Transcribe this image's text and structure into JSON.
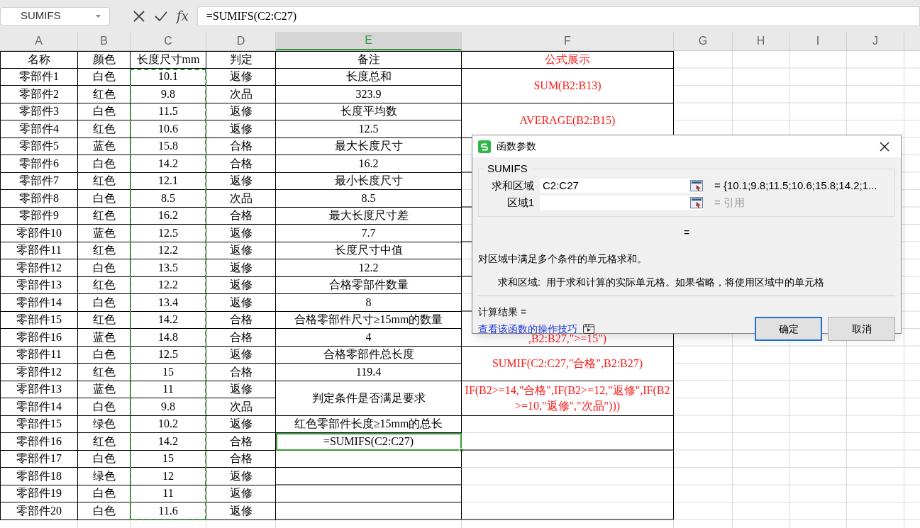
{
  "name_box": {
    "value": "SUMIFS"
  },
  "formula_bar": {
    "fx": "fx",
    "value": "=SUMIFS(C2:C27)"
  },
  "columns": [
    {
      "label": "A",
      "selected": false
    },
    {
      "label": "B",
      "selected": false
    },
    {
      "label": "C",
      "selected": false
    },
    {
      "label": "D",
      "selected": false
    },
    {
      "label": "E",
      "selected": true
    },
    {
      "label": "F",
      "selected": false
    },
    {
      "label": "G",
      "selected": false
    },
    {
      "label": "H",
      "selected": false
    },
    {
      "label": "I",
      "selected": false
    },
    {
      "label": "J",
      "selected": false
    }
  ],
  "table": {
    "header": [
      "名称",
      "颜色",
      "长度尺寸mm",
      "判定"
    ],
    "rows": [
      [
        "零部件1",
        "白色",
        "10.1",
        "返修"
      ],
      [
        "零部件2",
        "红色",
        "9.8",
        "次品"
      ],
      [
        "零部件3",
        "白色",
        "11.5",
        "返修"
      ],
      [
        "零部件4",
        "红色",
        "10.6",
        "返修"
      ],
      [
        "零部件5",
        "蓝色",
        "15.8",
        "合格"
      ],
      [
        "零部件6",
        "白色",
        "14.2",
        "合格"
      ],
      [
        "零部件7",
        "红色",
        "12.1",
        "返修"
      ],
      [
        "零部件8",
        "白色",
        "8.5",
        "次品"
      ],
      [
        "零部件9",
        "红色",
        "16.2",
        "合格"
      ],
      [
        "零部件10",
        "蓝色",
        "12.5",
        "返修"
      ],
      [
        "零部件11",
        "红色",
        "12.2",
        "返修"
      ],
      [
        "零部件12",
        "白色",
        "13.5",
        "返修"
      ],
      [
        "零部件13",
        "红色",
        "12.2",
        "返修"
      ],
      [
        "零部件14",
        "白色",
        "13.4",
        "返修"
      ],
      [
        "零部件15",
        "红色",
        "14.2",
        "合格"
      ],
      [
        "零部件16",
        "蓝色",
        "14.8",
        "合格"
      ],
      [
        "零部件11",
        "白色",
        "12.5",
        "返修"
      ],
      [
        "零部件12",
        "红色",
        "15",
        "合格"
      ],
      [
        "零部件13",
        "蓝色",
        "11",
        "返修"
      ],
      [
        "零部件14",
        "白色",
        "9.8",
        "次品"
      ],
      [
        "零部件15",
        "绿色",
        "10.2",
        "返修"
      ],
      [
        "零部件16",
        "红色",
        "14.2",
        "合格"
      ],
      [
        "零部件17",
        "白色",
        "15",
        "合格"
      ],
      [
        "零部件18",
        "绿色",
        "12",
        "返修"
      ],
      [
        "零部件19",
        "白色",
        "11",
        "返修"
      ],
      [
        "零部件20",
        "白色",
        "11.6",
        "返修"
      ]
    ]
  },
  "notes_column": [
    {
      "text": "备注",
      "kind": "single",
      "selected": false
    },
    {
      "text": "长度总和",
      "kind": "single",
      "selected": false
    },
    {
      "text": "323.9",
      "kind": "single",
      "selected": false
    },
    {
      "text": "长度平均数",
      "kind": "single",
      "selected": false
    },
    {
      "text": "12.5",
      "kind": "single",
      "selected": false
    },
    {
      "text": "最大长度尺寸",
      "kind": "single",
      "selected": false
    },
    {
      "text": "16.2",
      "kind": "single",
      "selected": false
    },
    {
      "text": "最小长度尺寸",
      "kind": "single",
      "selected": false
    },
    {
      "text": "8.5",
      "kind": "single",
      "selected": false
    },
    {
      "text": "最大长度尺寸差",
      "kind": "single",
      "selected": false
    },
    {
      "text": "7.7",
      "kind": "single",
      "selected": false
    },
    {
      "text": "长度尺寸中值",
      "kind": "single",
      "selected": false
    },
    {
      "text": "12.2",
      "kind": "single",
      "selected": false
    },
    {
      "text": "合格零部件数量",
      "kind": "single",
      "selected": false
    },
    {
      "text": "8",
      "kind": "single",
      "selected": false
    },
    {
      "text": "合格零部件尺寸≥15mm的数量",
      "kind": "single",
      "selected": false
    },
    {
      "text": "4",
      "kind": "single",
      "selected": false
    },
    {
      "text": "合格零部件总长度",
      "kind": "single",
      "selected": false
    },
    {
      "text": "119.4",
      "kind": "single",
      "selected": false
    },
    {
      "text": "判定条件是否满足要求",
      "kind": "double",
      "selected": false
    },
    {
      "text": "红色零部件长度≥15mm的总长",
      "kind": "single",
      "selected": false
    },
    {
      "text": "=SUMIFS(C2:C27)",
      "kind": "single",
      "selected": true
    }
  ],
  "formula_column": [
    {
      "text": "公式展示",
      "kind": "single"
    },
    {
      "text": "SUM(B2:B13)",
      "kind": "double"
    },
    {
      "text": "AVERAGE(B2:B15)",
      "kind": "double"
    },
    {
      "kind": "double"
    },
    {
      "kind": "double"
    },
    {
      "kind": "double"
    },
    {
      "kind": "double"
    },
    {
      "kind": "double"
    },
    {
      "text": ",B2:B27,\">=15\")",
      "kind": "double"
    },
    {
      "text": "SUMIF(C2:C27,\"合格\",B2:B27)",
      "kind": "double"
    },
    {
      "text": "IF(B2>=14,\"合格\",IF(B2>=12,\"返修\",IF(B2>=10,\"返修\",\"次品\")))",
      "kind": "double"
    },
    {
      "kind": "double"
    },
    {
      "kind": "quad"
    }
  ],
  "dialog": {
    "title": "函数参数",
    "group": "SUMIFS",
    "args": [
      {
        "label": "求和区域",
        "value": "C2:C27",
        "result": "= {10.1;9.8;11.5;10.6;15.8;14.2;1...",
        "muted": false
      },
      {
        "label": "区域1",
        "result": "= 引用",
        "muted": true
      }
    ],
    "formula_result": "=",
    "description": "对区域中满足多个条件的单元格求和。",
    "arg_help": {
      "label": "求和区域:",
      "text": "用于求和计算的实际单元格。如果省略，将使用区域中的单元格"
    },
    "result_label": "计算结果 =",
    "help_link": "查看该函数的操作技巧",
    "buttons": [
      {
        "label": "确定",
        "focused": true
      },
      {
        "label": "取消",
        "focused": false
      }
    ]
  }
}
